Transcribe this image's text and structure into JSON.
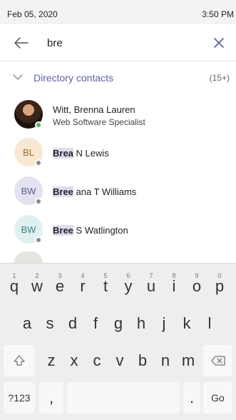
{
  "status": {
    "date": "Feb 05, 2020",
    "time": "3:50 PM"
  },
  "search": {
    "query": "bre"
  },
  "section": {
    "title": "Directory contacts",
    "count": "(15+)"
  },
  "contacts": [
    {
      "initials": "",
      "name_highlight": "Witt, Brenna Lauren",
      "name_rest": "",
      "role": "Web Software Specialist",
      "avatar_color": "#3b2418",
      "presence_color": "#5ab55a",
      "has_photo": true
    },
    {
      "initials": "BL",
      "name_highlight": "Brea",
      "name_rest": " N Lewis",
      "role": "",
      "avatar_color": "#f8e8d2",
      "initials_color": "#9b6b2e",
      "presence_color": "#8a8a8a",
      "has_photo": false
    },
    {
      "initials": "BW",
      "name_highlight": "Bree",
      "name_rest": " ana T Williams",
      "role": "",
      "avatar_color": "#e3e2f1",
      "initials_color": "#5d5b8f",
      "presence_color": "#8a8a8a",
      "has_photo": false
    },
    {
      "initials": "BW",
      "name_highlight": "Bree",
      "name_rest": " S Watlington",
      "role": "",
      "avatar_color": "#dff0f1",
      "initials_color": "#3a7d85",
      "presence_color": "#8a8a8a",
      "has_photo": false
    }
  ],
  "keyboard": {
    "row1": [
      {
        "key": "q",
        "hint": "1"
      },
      {
        "key": "w",
        "hint": "2"
      },
      {
        "key": "e",
        "hint": "3"
      },
      {
        "key": "r",
        "hint": "4"
      },
      {
        "key": "t",
        "hint": "5"
      },
      {
        "key": "y",
        "hint": "6"
      },
      {
        "key": "u",
        "hint": "7"
      },
      {
        "key": "i",
        "hint": "8"
      },
      {
        "key": "o",
        "hint": "9"
      },
      {
        "key": "p",
        "hint": "0"
      }
    ],
    "row2": [
      "a",
      "s",
      "d",
      "f",
      "g",
      "h",
      "j",
      "k",
      "l"
    ],
    "row3": [
      "z",
      "x",
      "c",
      "v",
      "b",
      "n",
      "m"
    ],
    "symbols": "?123",
    "comma": ",",
    "period": ".",
    "go": "Go"
  },
  "icons": {
    "back": "arrow-left-icon",
    "clear": "close-icon",
    "section": "chevron-down-icon",
    "shift": "shift-icon",
    "backspace": "backspace-icon"
  }
}
